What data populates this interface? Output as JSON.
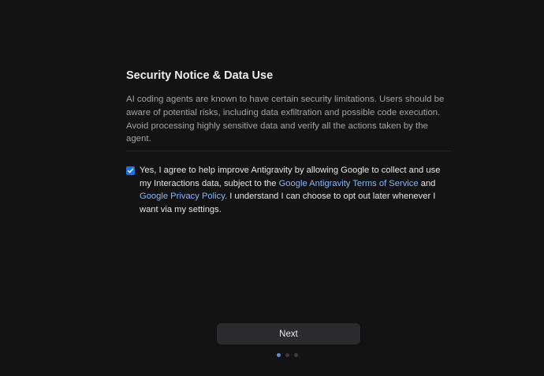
{
  "onboarding": {
    "title": "Security Notice & Data Use",
    "notice": "AI coding agents are known to have certain security limitations. Users should be aware of potential risks, including data exfiltration and possible code execution. Avoid processing highly sensitive data and verify all the actions taken by the agent.",
    "consent": {
      "checked": true,
      "text_before": "Yes, I agree to help improve Antigravity by allowing Google to collect and use my Interactions data, subject to the ",
      "terms_link": "Google Antigravity Terms of Service",
      "text_and": " and ",
      "privacy_link": "Google Privacy Policy",
      "text_after": ". I understand I can choose to opt out later whenever I want via my settings."
    },
    "next_label": "Next",
    "pager": {
      "total_steps": 3,
      "current_step": 1
    }
  },
  "colors": {
    "background": "#131314",
    "accent": "#1a73e8",
    "link": "#8ab4f8",
    "button_bg": "#2b2b2d"
  },
  "icons": {
    "checkbox": "check-icon"
  }
}
